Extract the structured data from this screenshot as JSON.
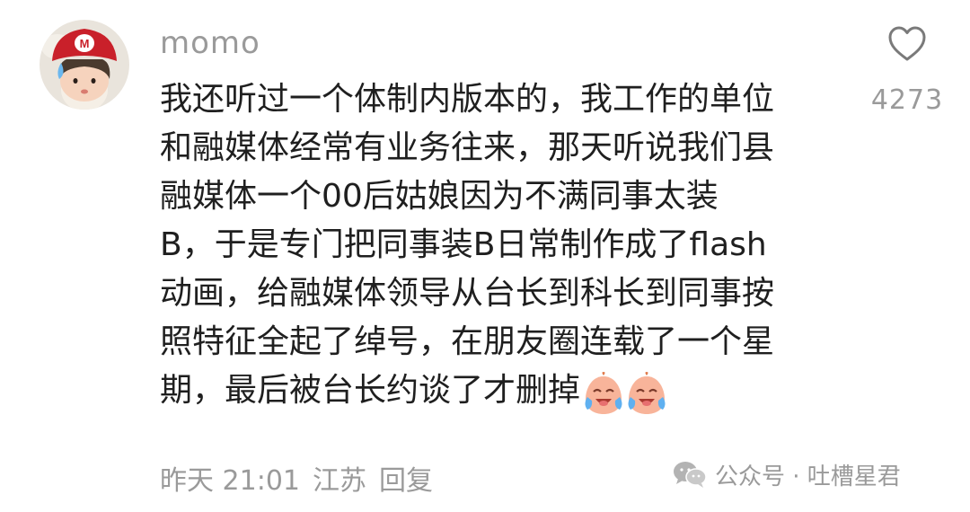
{
  "comment": {
    "username": "momo",
    "lines": [
      "我还听过一个体制内版本的，我工作的单位",
      "和融媒体经常有业务往来，那天听说我们县",
      "融媒体一个00后姑娘因为不满同事太装",
      "B，于是专门把同事装B日常制作成了flash",
      "动画，给融媒体领导从台长到科长到同事按",
      "照特征全起了绰号，在朋友圈连载了一个星",
      "期，最后被台长约谈了才删掉"
    ],
    "emoji_names": [
      "laugh-cry-emoji",
      "laugh-cry-emoji"
    ],
    "time": "昨天 21:01",
    "location": "江苏",
    "reply_label": "回复",
    "likes": "4273"
  },
  "watermark": {
    "text": "公众号 · 吐槽星君",
    "icon": "wechat-icon"
  },
  "colors": {
    "secondary_text": "#9a9a9a",
    "primary_text": "#1f1f1f",
    "avatar_hat": "#c9202a"
  }
}
